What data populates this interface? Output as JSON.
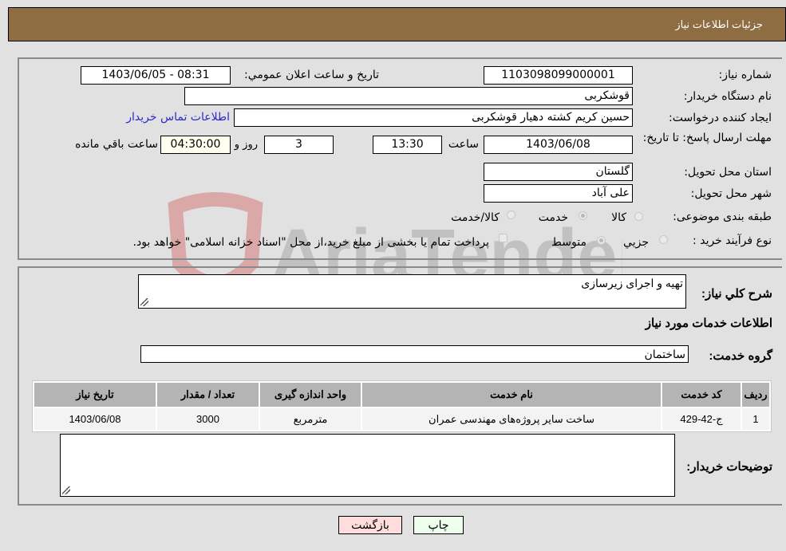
{
  "header": {
    "title": "جزئیات اطلاعات نیاز"
  },
  "form": {
    "need_number_label": "شماره نیاز:",
    "need_number": "1103098099000001",
    "announce_label": "تاریخ و ساعت اعلان عمومي:",
    "announce_value": "1403/06/05 - 08:31",
    "buyer_org_label": "نام دستگاه خریدار:",
    "buyer_org": "قوشکربی",
    "creator_label": "ایجاد کننده درخواست:",
    "creator": "حسین کریم کشته دهیار قوشکربی",
    "contact_link": "اطلاعات تماس خریدار",
    "deadline_label": "مهلت ارسال پاسخ: تا تاریخ:",
    "deadline_date": "1403/06/08",
    "time_label": "ساعت",
    "deadline_time": "13:30",
    "days_value": "3",
    "days_label": "روز و",
    "remaining_time": "04:30:00",
    "remaining_label": "ساعت باقي مانده",
    "province_label": "استان محل تحویل:",
    "province": "گلستان",
    "city_label": "شهر محل تحویل:",
    "city": "علی آباد",
    "category_label": "طبقه بندی موضوعی:",
    "category_options": [
      {
        "label": "کالا",
        "selected": false
      },
      {
        "label": "خدمت",
        "selected": true
      },
      {
        "label": "کالا/خدمت",
        "selected": false
      }
    ],
    "process_label": "نوع فرآیند خرید :",
    "process_options": [
      {
        "label": "جزيي",
        "selected": false
      },
      {
        "label": "متوسط",
        "selected": true
      }
    ],
    "treasury_note": "پرداخت تمام یا بخشی از مبلغ خرید،از محل \"اسناد خزانه اسلامی\" خواهد بود.",
    "treasury_checked": false
  },
  "details": {
    "description_label": "شرح کلي نیاز:",
    "description": "تهیه و اجرای زیرسازی",
    "services_heading": "اطلاعات خدمات مورد نیاز",
    "service_group_label": "گروه خدمت:",
    "service_group": "ساختمان",
    "table": {
      "headers": [
        "ردیف",
        "کد خدمت",
        "نام خدمت",
        "واحد اندازه گیری",
        "تعداد / مقدار",
        "تاریخ نیاز"
      ],
      "rows": [
        [
          "1",
          "ج-42-429",
          "ساخت سایر پروژه‌های مهندسی عمران",
          "مترمربع",
          "3000",
          "1403/06/08"
        ]
      ]
    },
    "buyer_notes_label": "توضیحات خریدار:",
    "buyer_notes": ""
  },
  "buttons": {
    "print": "چاپ",
    "back": "بازگشت"
  },
  "watermark": {
    "text": "AriaTender.neT"
  },
  "colors": {
    "header_bg": "#8e6d42",
    "print_bg": "#eeffee",
    "back_bg": "#ffdddd",
    "link": "#2a2acc"
  }
}
